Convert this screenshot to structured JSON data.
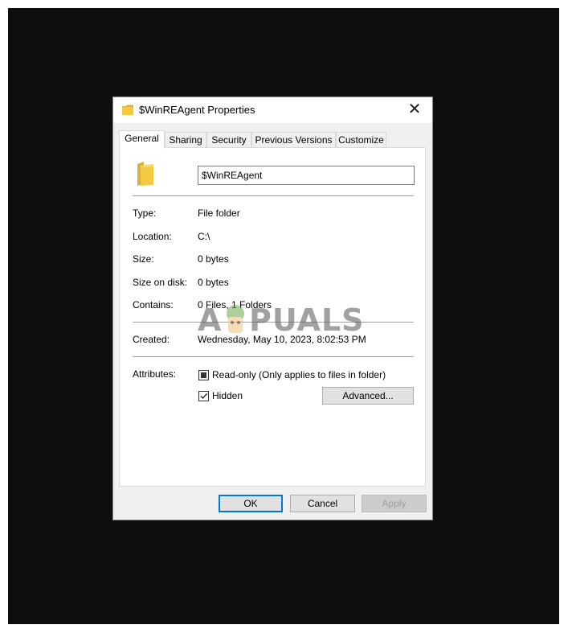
{
  "window": {
    "title": "$WinREAgent Properties",
    "close_glyph": "✕"
  },
  "tabs": [
    {
      "label": "General",
      "active": true
    },
    {
      "label": "Sharing",
      "active": false
    },
    {
      "label": "Security",
      "active": false
    },
    {
      "label": "Previous Versions",
      "active": false
    },
    {
      "label": "Customize",
      "active": false
    }
  ],
  "general": {
    "name_value": "$WinREAgent",
    "type_label": "Type:",
    "type_value": "File folder",
    "location_label": "Location:",
    "location_value": "C:\\",
    "size_label": "Size:",
    "size_value": "0 bytes",
    "size_on_disk_label": "Size on disk:",
    "size_on_disk_value": "0 bytes",
    "contains_label": "Contains:",
    "contains_value": "0 Files, 1 Folders",
    "created_label": "Created:",
    "created_value": "Wednesday, May 10, 2023, 8:02:53 PM",
    "attributes_label": "Attributes:",
    "readonly_label": "Read-only (Only applies to files in folder)",
    "readonly_state": "indeterminate",
    "hidden_label": "Hidden",
    "hidden_checked": true,
    "advanced_label": "Advanced..."
  },
  "footer": {
    "ok_label": "OK",
    "cancel_label": "Cancel",
    "apply_label": "Apply"
  },
  "watermark": {
    "text_a": "A",
    "text_rest": "PUALS"
  },
  "colors": {
    "frame_bg": "#0e0e0e",
    "accent": "#0078d7",
    "folder": "#f5c842"
  }
}
